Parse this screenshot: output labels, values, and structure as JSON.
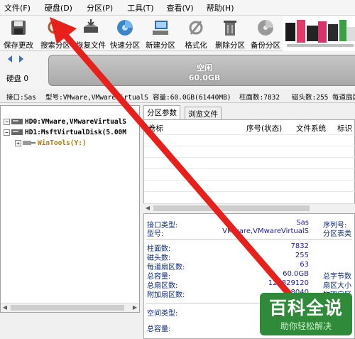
{
  "menu": [
    {
      "name": "menu-file",
      "label": "文件(F)"
    },
    {
      "name": "menu-disk",
      "label": "硬盘(D)"
    },
    {
      "name": "menu-partition",
      "label": "分区(P)"
    },
    {
      "name": "menu-tools",
      "label": "工具(T)"
    },
    {
      "name": "menu-view",
      "label": "查看(V)"
    },
    {
      "name": "menu-help",
      "label": "帮助(H)"
    }
  ],
  "toolbar": {
    "save": "保存更改",
    "search": "搜索分区",
    "recover": "恢复文件",
    "quick": "快速分区",
    "new": "新建分区",
    "format": "格式化",
    "delete": "删除分区",
    "backup": "备份分区"
  },
  "diskbar": {
    "disk_label": "硬盘 0",
    "partition_name": "空闲",
    "partition_size": "60.0GB"
  },
  "infobar": {
    "interface": "接口:Sas",
    "model": "型号:VMware,VMwareVirtualS",
    "capacity": "容量:60.0GB(61440MB)",
    "cylinders": "柱面数:7832",
    "heads": "磁头数:255",
    "sectors": "每道扇区"
  },
  "tree": {
    "hd0": "HD0:VMware,VMwareVirtualS",
    "hd1": "HD1:MsftVirtualDisk(5.00M",
    "wintools": "WinTools(Y:)"
  },
  "tabs": {
    "params": "分区参数",
    "browse": "浏览文件"
  },
  "table_headers": {
    "label": "卷标",
    "seq": "序号(状态)",
    "fs": "文件系统",
    "id": "标识"
  },
  "details": {
    "interface_label": "接口类型:",
    "interface_val": "Sas",
    "serial_label": "序列号:",
    "model_label": "型号:",
    "model_val": "VMware,VMwareVirtualS",
    "table_type_label": "分区表类",
    "cyl_label": "柱面数:",
    "cyl_val": "7832",
    "heads_label": "磁头数:",
    "heads_val": "255",
    "spt_label": "每道扇区数:",
    "spt_val": "63",
    "cap_label": "总容量:",
    "cap_val": "60.0GB",
    "bytes_label": "总字节数",
    "sectors_label": "总扇区数:",
    "sectors_val": "125829120",
    "sector_size_label": "扇区大小",
    "extra_label": "附加扇区数:",
    "extra_val": "8040",
    "phys_label": "物理扇区",
    "space_type_label": "空间类型:",
    "total_cap2_label": "总容量:"
  },
  "watermark": {
    "title": "百科全说",
    "subtitle": "助你轻松解决"
  },
  "colors": {
    "annotation_arrow": "#e8201c",
    "partition_bar": "#b5b5b5",
    "watermark_bg": "#2f8a3a"
  }
}
